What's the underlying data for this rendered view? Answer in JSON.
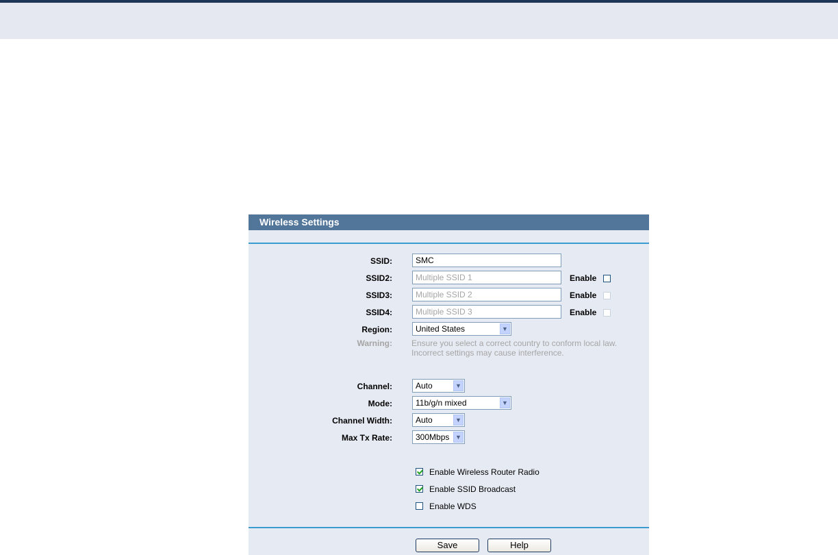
{
  "panel": {
    "title": "Wireless Settings",
    "ssid": {
      "label": "SSID:",
      "value": "SMC"
    },
    "ssid2": {
      "label": "SSID2:",
      "placeholder": "Multiple SSID 1",
      "enable_label": "Enable",
      "enabled": false
    },
    "ssid3": {
      "label": "SSID3:",
      "placeholder": "Multiple SSID 2",
      "enable_label": "Enable",
      "enabled": false
    },
    "ssid4": {
      "label": "SSID4:",
      "placeholder": "Multiple SSID 3",
      "enable_label": "Enable",
      "enabled": false
    },
    "region": {
      "label": "Region:",
      "value": "United States"
    },
    "warning": {
      "label": "Warning:",
      "line1": "Ensure you select a correct country to conform local law.",
      "line2": "Incorrect settings may cause interference."
    },
    "channel": {
      "label": "Channel:",
      "value": "Auto"
    },
    "mode": {
      "label": "Mode:",
      "value": "11b/g/n mixed"
    },
    "channel_width": {
      "label": "Channel Width:",
      "value": "Auto"
    },
    "max_tx_rate": {
      "label": "Max Tx Rate:",
      "value": "300Mbps"
    },
    "options": [
      {
        "label": "Enable Wireless Router Radio",
        "checked": true
      },
      {
        "label": "Enable SSID Broadcast",
        "checked": true
      },
      {
        "label": "Enable WDS",
        "checked": false
      }
    ],
    "buttons": {
      "save": "Save",
      "help": "Help"
    }
  },
  "colors": {
    "header_bg": "#52769a",
    "panel_bg": "#e6eaf2",
    "divider": "#3a9bd0",
    "check": "#21a121"
  }
}
